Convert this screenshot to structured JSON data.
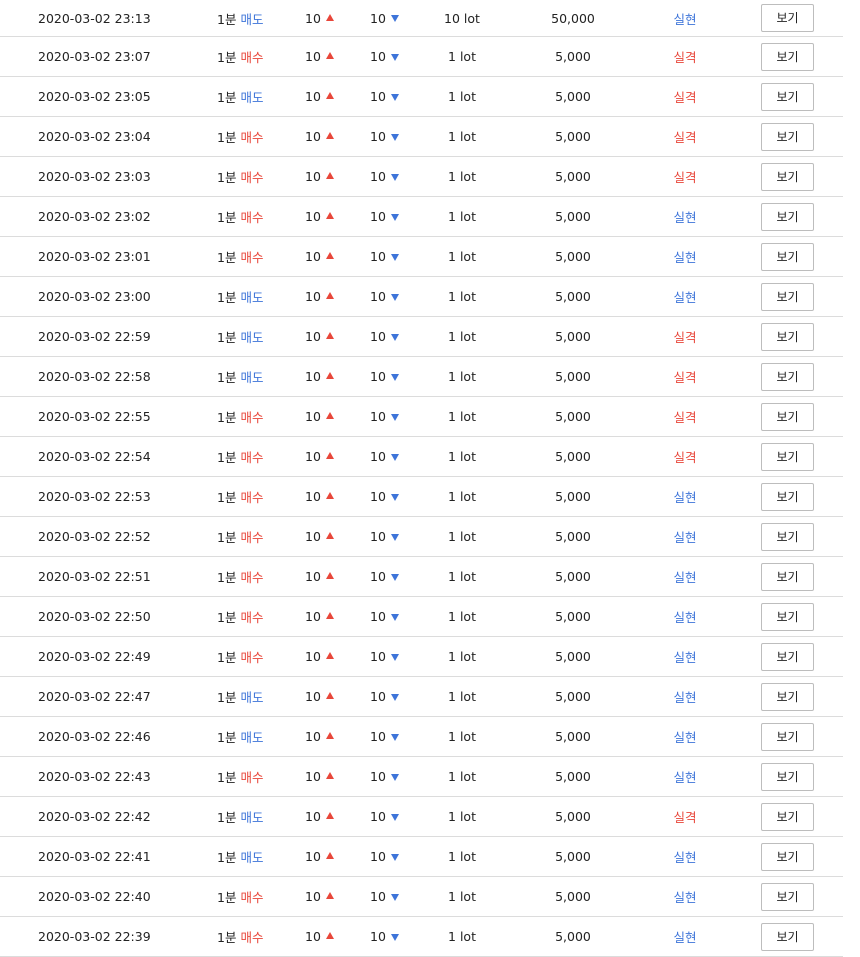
{
  "colors": {
    "sell": "#3d74d9",
    "buy": "#e8463a",
    "up_arrow": "#e8463a",
    "down_arrow": "#3d74d9",
    "border": "#dcdcdc"
  },
  "icons": {
    "up": "triangle-up-icon",
    "down": "triangle-down-icon"
  },
  "table": {
    "rows": [
      {
        "datetime": "2020-03-02 23:13",
        "interval": "1분",
        "direction": "매도",
        "direction_color": "blue",
        "up": "10",
        "down": "10",
        "lot": "10 lot",
        "amount": "50,000",
        "result": "실현",
        "result_color": "blue",
        "button": "보기"
      },
      {
        "datetime": "2020-03-02 23:07",
        "interval": "1분",
        "direction": "매수",
        "direction_color": "red",
        "up": "10",
        "down": "10",
        "lot": "1 lot",
        "amount": "5,000",
        "result": "실격",
        "result_color": "red",
        "button": "보기"
      },
      {
        "datetime": "2020-03-02 23:05",
        "interval": "1분",
        "direction": "매도",
        "direction_color": "blue",
        "up": "10",
        "down": "10",
        "lot": "1 lot",
        "amount": "5,000",
        "result": "실격",
        "result_color": "red",
        "button": "보기"
      },
      {
        "datetime": "2020-03-02 23:04",
        "interval": "1분",
        "direction": "매수",
        "direction_color": "red",
        "up": "10",
        "down": "10",
        "lot": "1 lot",
        "amount": "5,000",
        "result": "실격",
        "result_color": "red",
        "button": "보기"
      },
      {
        "datetime": "2020-03-02 23:03",
        "interval": "1분",
        "direction": "매수",
        "direction_color": "red",
        "up": "10",
        "down": "10",
        "lot": "1 lot",
        "amount": "5,000",
        "result": "실격",
        "result_color": "red",
        "button": "보기"
      },
      {
        "datetime": "2020-03-02 23:02",
        "interval": "1분",
        "direction": "매수",
        "direction_color": "red",
        "up": "10",
        "down": "10",
        "lot": "1 lot",
        "amount": "5,000",
        "result": "실현",
        "result_color": "blue",
        "button": "보기"
      },
      {
        "datetime": "2020-03-02 23:01",
        "interval": "1분",
        "direction": "매수",
        "direction_color": "red",
        "up": "10",
        "down": "10",
        "lot": "1 lot",
        "amount": "5,000",
        "result": "실현",
        "result_color": "blue",
        "button": "보기"
      },
      {
        "datetime": "2020-03-02 23:00",
        "interval": "1분",
        "direction": "매도",
        "direction_color": "blue",
        "up": "10",
        "down": "10",
        "lot": "1 lot",
        "amount": "5,000",
        "result": "실현",
        "result_color": "blue",
        "button": "보기"
      },
      {
        "datetime": "2020-03-02 22:59",
        "interval": "1분",
        "direction": "매도",
        "direction_color": "blue",
        "up": "10",
        "down": "10",
        "lot": "1 lot",
        "amount": "5,000",
        "result": "실격",
        "result_color": "red",
        "button": "보기"
      },
      {
        "datetime": "2020-03-02 22:58",
        "interval": "1분",
        "direction": "매도",
        "direction_color": "blue",
        "up": "10",
        "down": "10",
        "lot": "1 lot",
        "amount": "5,000",
        "result": "실격",
        "result_color": "red",
        "button": "보기"
      },
      {
        "datetime": "2020-03-02 22:55",
        "interval": "1분",
        "direction": "매수",
        "direction_color": "red",
        "up": "10",
        "down": "10",
        "lot": "1 lot",
        "amount": "5,000",
        "result": "실격",
        "result_color": "red",
        "button": "보기"
      },
      {
        "datetime": "2020-03-02 22:54",
        "interval": "1분",
        "direction": "매수",
        "direction_color": "red",
        "up": "10",
        "down": "10",
        "lot": "1 lot",
        "amount": "5,000",
        "result": "실격",
        "result_color": "red",
        "button": "보기"
      },
      {
        "datetime": "2020-03-02 22:53",
        "interval": "1분",
        "direction": "매수",
        "direction_color": "red",
        "up": "10",
        "down": "10",
        "lot": "1 lot",
        "amount": "5,000",
        "result": "실현",
        "result_color": "blue",
        "button": "보기"
      },
      {
        "datetime": "2020-03-02 22:52",
        "interval": "1분",
        "direction": "매수",
        "direction_color": "red",
        "up": "10",
        "down": "10",
        "lot": "1 lot",
        "amount": "5,000",
        "result": "실현",
        "result_color": "blue",
        "button": "보기"
      },
      {
        "datetime": "2020-03-02 22:51",
        "interval": "1분",
        "direction": "매수",
        "direction_color": "red",
        "up": "10",
        "down": "10",
        "lot": "1 lot",
        "amount": "5,000",
        "result": "실현",
        "result_color": "blue",
        "button": "보기"
      },
      {
        "datetime": "2020-03-02 22:50",
        "interval": "1분",
        "direction": "매수",
        "direction_color": "red",
        "up": "10",
        "down": "10",
        "lot": "1 lot",
        "amount": "5,000",
        "result": "실현",
        "result_color": "blue",
        "button": "보기"
      },
      {
        "datetime": "2020-03-02 22:49",
        "interval": "1분",
        "direction": "매수",
        "direction_color": "red",
        "up": "10",
        "down": "10",
        "lot": "1 lot",
        "amount": "5,000",
        "result": "실현",
        "result_color": "blue",
        "button": "보기"
      },
      {
        "datetime": "2020-03-02 22:47",
        "interval": "1분",
        "direction": "매도",
        "direction_color": "blue",
        "up": "10",
        "down": "10",
        "lot": "1 lot",
        "amount": "5,000",
        "result": "실현",
        "result_color": "blue",
        "button": "보기"
      },
      {
        "datetime": "2020-03-02 22:46",
        "interval": "1분",
        "direction": "매도",
        "direction_color": "blue",
        "up": "10",
        "down": "10",
        "lot": "1 lot",
        "amount": "5,000",
        "result": "실현",
        "result_color": "blue",
        "button": "보기"
      },
      {
        "datetime": "2020-03-02 22:43",
        "interval": "1분",
        "direction": "매수",
        "direction_color": "red",
        "up": "10",
        "down": "10",
        "lot": "1 lot",
        "amount": "5,000",
        "result": "실현",
        "result_color": "blue",
        "button": "보기"
      },
      {
        "datetime": "2020-03-02 22:42",
        "interval": "1분",
        "direction": "매도",
        "direction_color": "blue",
        "up": "10",
        "down": "10",
        "lot": "1 lot",
        "amount": "5,000",
        "result": "실격",
        "result_color": "red",
        "button": "보기"
      },
      {
        "datetime": "2020-03-02 22:41",
        "interval": "1분",
        "direction": "매도",
        "direction_color": "blue",
        "up": "10",
        "down": "10",
        "lot": "1 lot",
        "amount": "5,000",
        "result": "실현",
        "result_color": "blue",
        "button": "보기"
      },
      {
        "datetime": "2020-03-02 22:40",
        "interval": "1분",
        "direction": "매수",
        "direction_color": "red",
        "up": "10",
        "down": "10",
        "lot": "1 lot",
        "amount": "5,000",
        "result": "실현",
        "result_color": "blue",
        "button": "보기"
      },
      {
        "datetime": "2020-03-02 22:39",
        "interval": "1분",
        "direction": "매수",
        "direction_color": "red",
        "up": "10",
        "down": "10",
        "lot": "1 lot",
        "amount": "5,000",
        "result": "실현",
        "result_color": "blue",
        "button": "보기"
      }
    ]
  }
}
